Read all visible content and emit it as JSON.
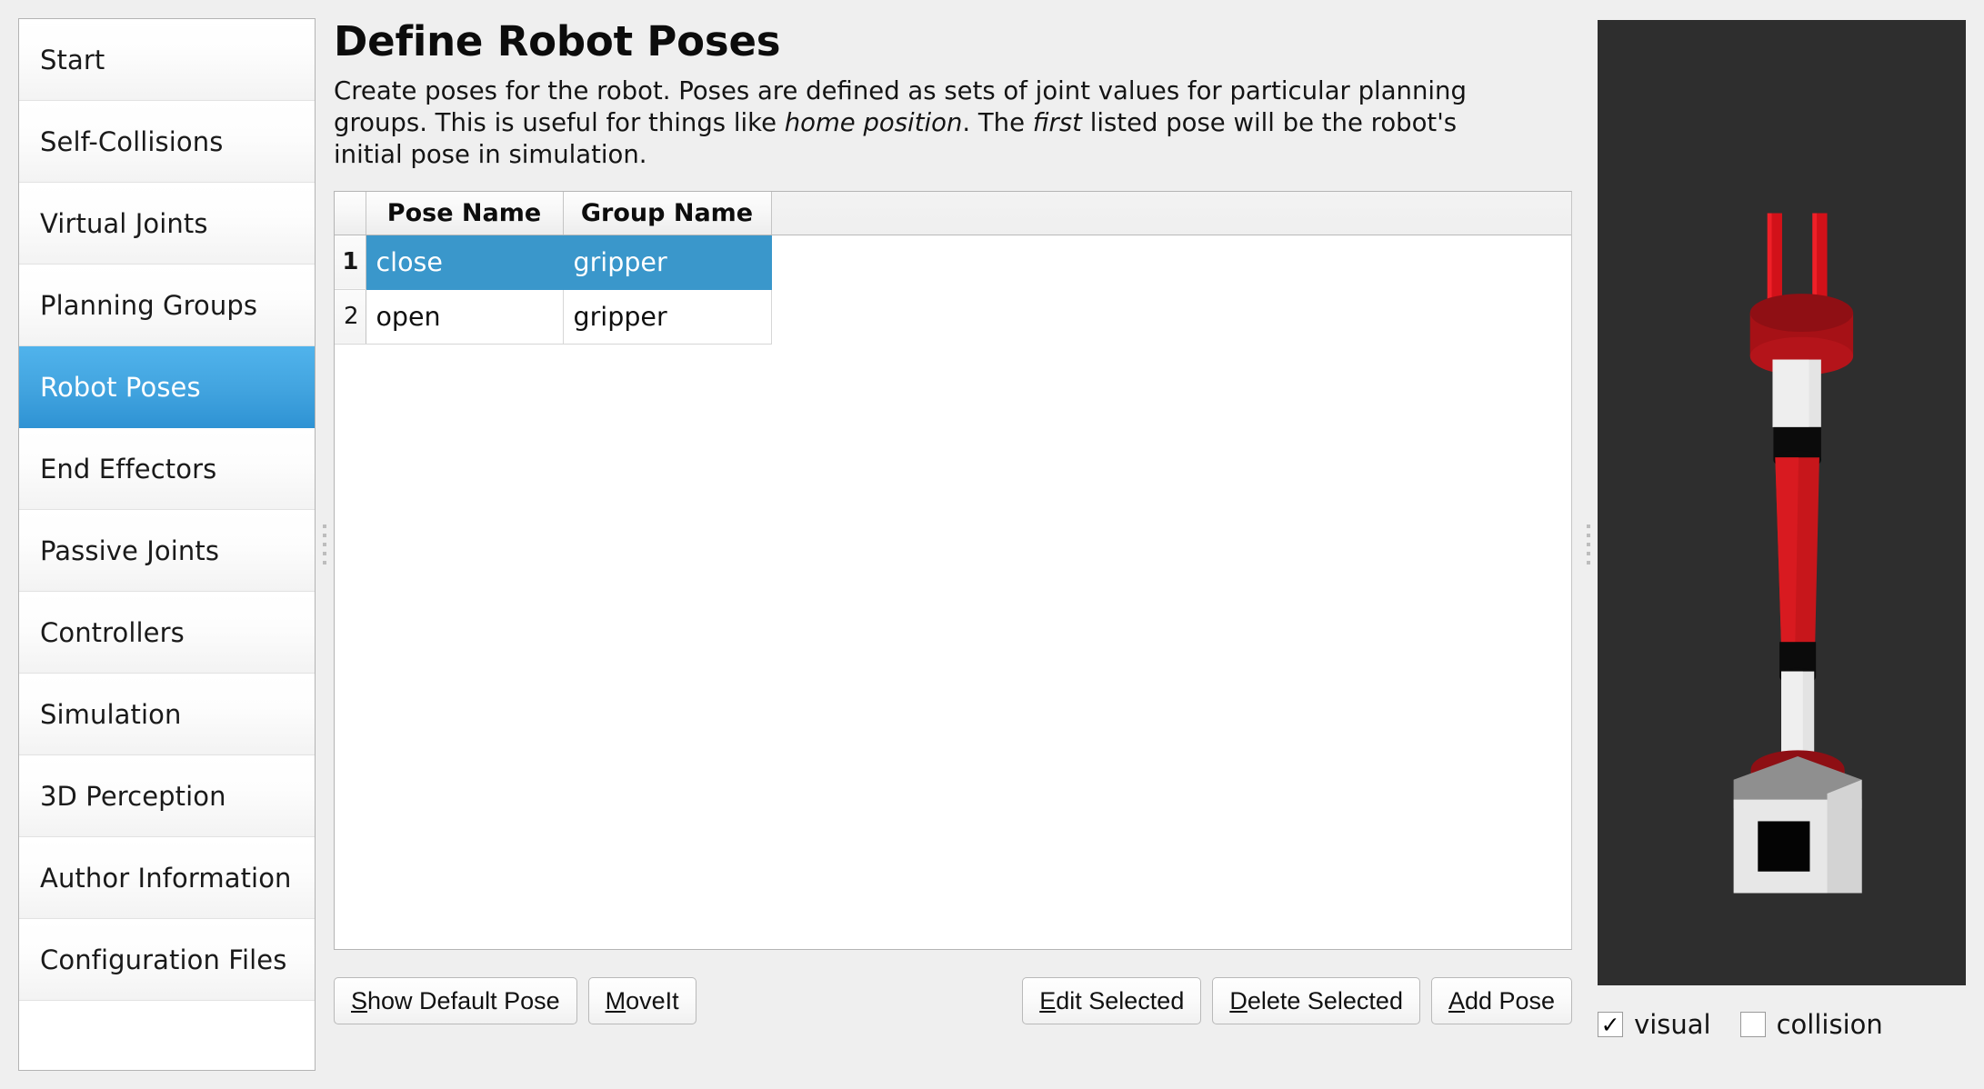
{
  "sidebar": {
    "items": [
      {
        "label": "Start",
        "selected": false
      },
      {
        "label": "Self-Collisions",
        "selected": false
      },
      {
        "label": "Virtual Joints",
        "selected": false
      },
      {
        "label": "Planning Groups",
        "selected": false
      },
      {
        "label": "Robot Poses",
        "selected": true
      },
      {
        "label": "End Effectors",
        "selected": false
      },
      {
        "label": "Passive Joints",
        "selected": false
      },
      {
        "label": "Controllers",
        "selected": false
      },
      {
        "label": "Simulation",
        "selected": false
      },
      {
        "label": "3D Perception",
        "selected": false
      },
      {
        "label": "Author Information",
        "selected": false
      },
      {
        "label": "Configuration Files",
        "selected": false
      }
    ]
  },
  "main": {
    "title": "Define Robot Poses",
    "description": {
      "part1": "Create poses for the robot. Poses are defined as sets of joint values for particular planning groups. This is useful for things like ",
      "em1": "home position",
      "part2": ". The ",
      "em2": "first",
      "part3": " listed pose will be the robot's initial pose in simulation."
    },
    "table": {
      "columns": [
        "Pose Name",
        "Group Name"
      ],
      "rows": [
        {
          "num": "1",
          "pose_name": "close",
          "group_name": "gripper",
          "selected": true
        },
        {
          "num": "2",
          "pose_name": "open",
          "group_name": "gripper",
          "selected": false
        }
      ]
    },
    "buttons": {
      "show_default_pose": {
        "mnemonic": "S",
        "rest": "how Default Pose"
      },
      "moveit": {
        "mnemonic": "M",
        "rest": "oveIt"
      },
      "edit_selected": {
        "mnemonic": "E",
        "rest": "dit Selected"
      },
      "delete_selected": {
        "mnemonic": "D",
        "rest": "elete Selected"
      },
      "add_pose": {
        "mnemonic": "A",
        "rest": "dd Pose"
      }
    }
  },
  "viewer": {
    "background_color": "#2e2e2e",
    "checkboxes": [
      {
        "label": "visual",
        "checked": true,
        "mark": "✓"
      },
      {
        "label": "collision",
        "checked": false,
        "mark": ""
      }
    ]
  },
  "colors": {
    "selection_blue": "#3a97cb",
    "sidebar_selected_blue": "#43a5e0",
    "window_bg": "#efefef",
    "robot_red": "#c7161b",
    "robot_dark_red": "#9c1014",
    "robot_white": "#e8e8e8",
    "robot_black": "#0a0a0a",
    "robot_grey": "#8f8f8f"
  }
}
